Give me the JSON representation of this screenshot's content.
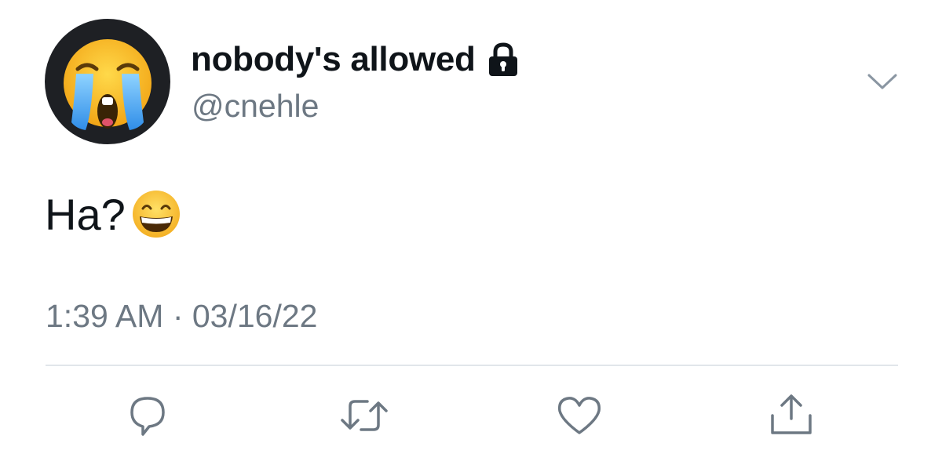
{
  "author": {
    "display_name": "nobody's allowed",
    "handle": "@cnehle",
    "avatar_icon": "loudly-crying-face-emoji",
    "protected_icon": "lock-icon"
  },
  "tweet": {
    "text": "Ha?",
    "emoji": "grinning-face-with-smiling-eyes-emoji",
    "timestamp": "1:39 AM · 03/16/22"
  },
  "menu": {
    "icon": "chevron-down-icon"
  },
  "actions": [
    {
      "icon": "reply-icon"
    },
    {
      "icon": "retweet-icon"
    },
    {
      "icon": "like-icon"
    },
    {
      "icon": "share-icon"
    }
  ],
  "colors": {
    "primary_text": "#0f1419",
    "secondary_text": "#6d7883",
    "divider": "#e1e6ea",
    "avatar_background": "#1e2024"
  }
}
